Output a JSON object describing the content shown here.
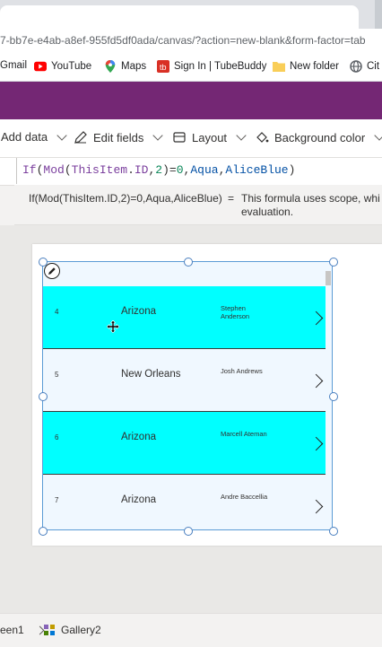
{
  "browser": {
    "url": "7-bb7e-e4ab-a8ef-955fd5df0ada/canvas/?action=new-blank&form-factor=tab",
    "bookmarks": [
      {
        "label": "Gmail",
        "icon": "gmail-icon"
      },
      {
        "label": "YouTube",
        "icon": "youtube-icon",
        "color": "#ff0000"
      },
      {
        "label": "Maps",
        "icon": "maps-icon"
      },
      {
        "label": "Sign In | TubeBuddy",
        "icon": "tubebuddy-icon",
        "color": "#d93025"
      },
      {
        "label": "New folder",
        "icon": "folder-icon",
        "color": "#f9ce58"
      },
      {
        "label": "Cit",
        "icon": "globe-icon"
      }
    ]
  },
  "app": {
    "header_color": "#742774"
  },
  "command_bar": {
    "add_data": "Add data",
    "edit_fields": "Edit fields",
    "layout": "Layout",
    "background_color": "Background color"
  },
  "formula": {
    "tokens": [
      {
        "t": "If",
        "c": "fn"
      },
      {
        "t": "(",
        "c": "kw"
      },
      {
        "t": "Mod",
        "c": "fn"
      },
      {
        "t": "(",
        "c": "kw"
      },
      {
        "t": "ThisItem",
        "c": "fn"
      },
      {
        "t": ".",
        "c": "kw"
      },
      {
        "t": "ID",
        "c": "fn"
      },
      {
        "t": ",",
        "c": "kw"
      },
      {
        "t": "2",
        "c": "num"
      },
      {
        "t": ")",
        "c": "kw"
      },
      {
        "t": "=",
        "c": "kw"
      },
      {
        "t": "0",
        "c": "num"
      },
      {
        "t": ",",
        "c": "kw"
      },
      {
        "t": "Aqua",
        "c": "id"
      },
      {
        "t": ",",
        "c": "kw"
      },
      {
        "t": "AliceBlue",
        "c": "id"
      },
      {
        "t": ")",
        "c": "kw"
      }
    ],
    "hint_expression": "If(Mod(ThisItem.ID,2)=0,Aqua,AliceBlue)",
    "hint_equals": "=",
    "hint_result": "This formula uses scope, whi evaluation."
  },
  "gallery": {
    "rows": [
      {
        "id": "4",
        "city": "Arizona",
        "name": "Stephen Anderson",
        "fill": "aqua"
      },
      {
        "id": "5",
        "city": "New Orleans",
        "name": "Josh Andrews",
        "fill": "ab"
      },
      {
        "id": "6",
        "city": "Arizona",
        "name": "Marcell Ateman",
        "fill": "aqua"
      },
      {
        "id": "7",
        "city": "Arizona",
        "name": "Andre Baccellia",
        "fill": "ab"
      }
    ],
    "colors": {
      "aqua": "#00ffff",
      "alice_blue": "#f0f8ff"
    }
  },
  "bottom": {
    "screen_tab": "een1",
    "gallery_tab": "Gallery2"
  }
}
